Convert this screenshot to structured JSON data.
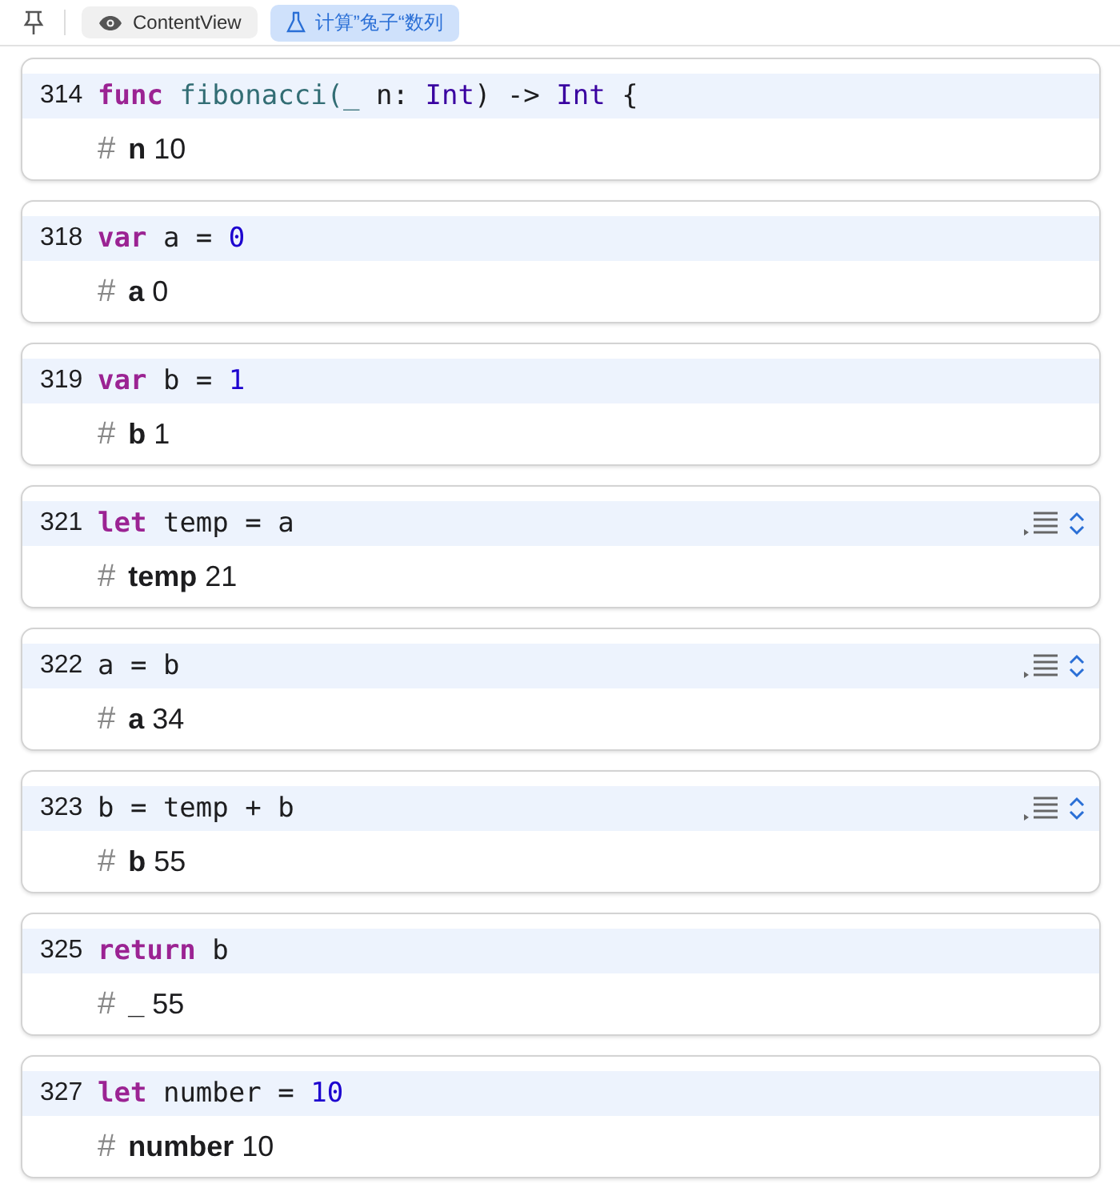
{
  "tabs": [
    {
      "label": "ContentView",
      "kind": "view",
      "selected": false
    },
    {
      "label": "计算”兔子“数列",
      "kind": "preview",
      "selected": true
    }
  ],
  "cards": [
    {
      "line": "314",
      "tokens": [
        {
          "t": "func",
          "kind": "keyword"
        },
        {
          "t": " fibonacci(",
          "kind": "function"
        },
        {
          "t": "_",
          "kind": "function"
        },
        {
          "t": " n: ",
          "kind": "plain"
        },
        {
          "t": "Int",
          "kind": "type"
        },
        {
          "t": ") -> ",
          "kind": "plain"
        },
        {
          "t": "Int",
          "kind": "type"
        },
        {
          "t": " {",
          "kind": "plain"
        }
      ],
      "marker": "#",
      "name": "n",
      "value": "10",
      "history": false
    },
    {
      "line": "318",
      "tokens": [
        {
          "t": "var",
          "kind": "keyword"
        },
        {
          "t": " a = ",
          "kind": "plain"
        },
        {
          "t": "0",
          "kind": "number"
        }
      ],
      "marker": "#",
      "name": "a",
      "value": "0",
      "history": false
    },
    {
      "line": "319",
      "tokens": [
        {
          "t": "var",
          "kind": "keyword"
        },
        {
          "t": " b = ",
          "kind": "plain"
        },
        {
          "t": "1",
          "kind": "number"
        }
      ],
      "marker": "#",
      "name": "b",
      "value": "1",
      "history": false
    },
    {
      "line": "321",
      "tokens": [
        {
          "t": "let",
          "kind": "keyword"
        },
        {
          "t": " temp = a",
          "kind": "plain"
        }
      ],
      "marker": "#",
      "name": "temp",
      "value": "21",
      "history": true
    },
    {
      "line": "322",
      "tokens": [
        {
          "t": "a = b",
          "kind": "plain"
        }
      ],
      "marker": "#",
      "name": "a",
      "value": "34",
      "history": true
    },
    {
      "line": "323",
      "tokens": [
        {
          "t": "b = temp + b",
          "kind": "plain"
        }
      ],
      "marker": "#",
      "name": "b",
      "value": "55",
      "history": true
    },
    {
      "line": "325",
      "tokens": [
        {
          "t": "return",
          "kind": "keyword"
        },
        {
          "t": " b",
          "kind": "plain"
        }
      ],
      "marker": "#",
      "name": "_",
      "value": "55",
      "history": false
    },
    {
      "line": "327",
      "tokens": [
        {
          "t": "let",
          "kind": "keyword"
        },
        {
          "t": " number = ",
          "kind": "plain"
        },
        {
          "t": "10",
          "kind": "number"
        }
      ],
      "marker": "#",
      "name": "number",
      "value": "10",
      "history": false
    }
  ]
}
